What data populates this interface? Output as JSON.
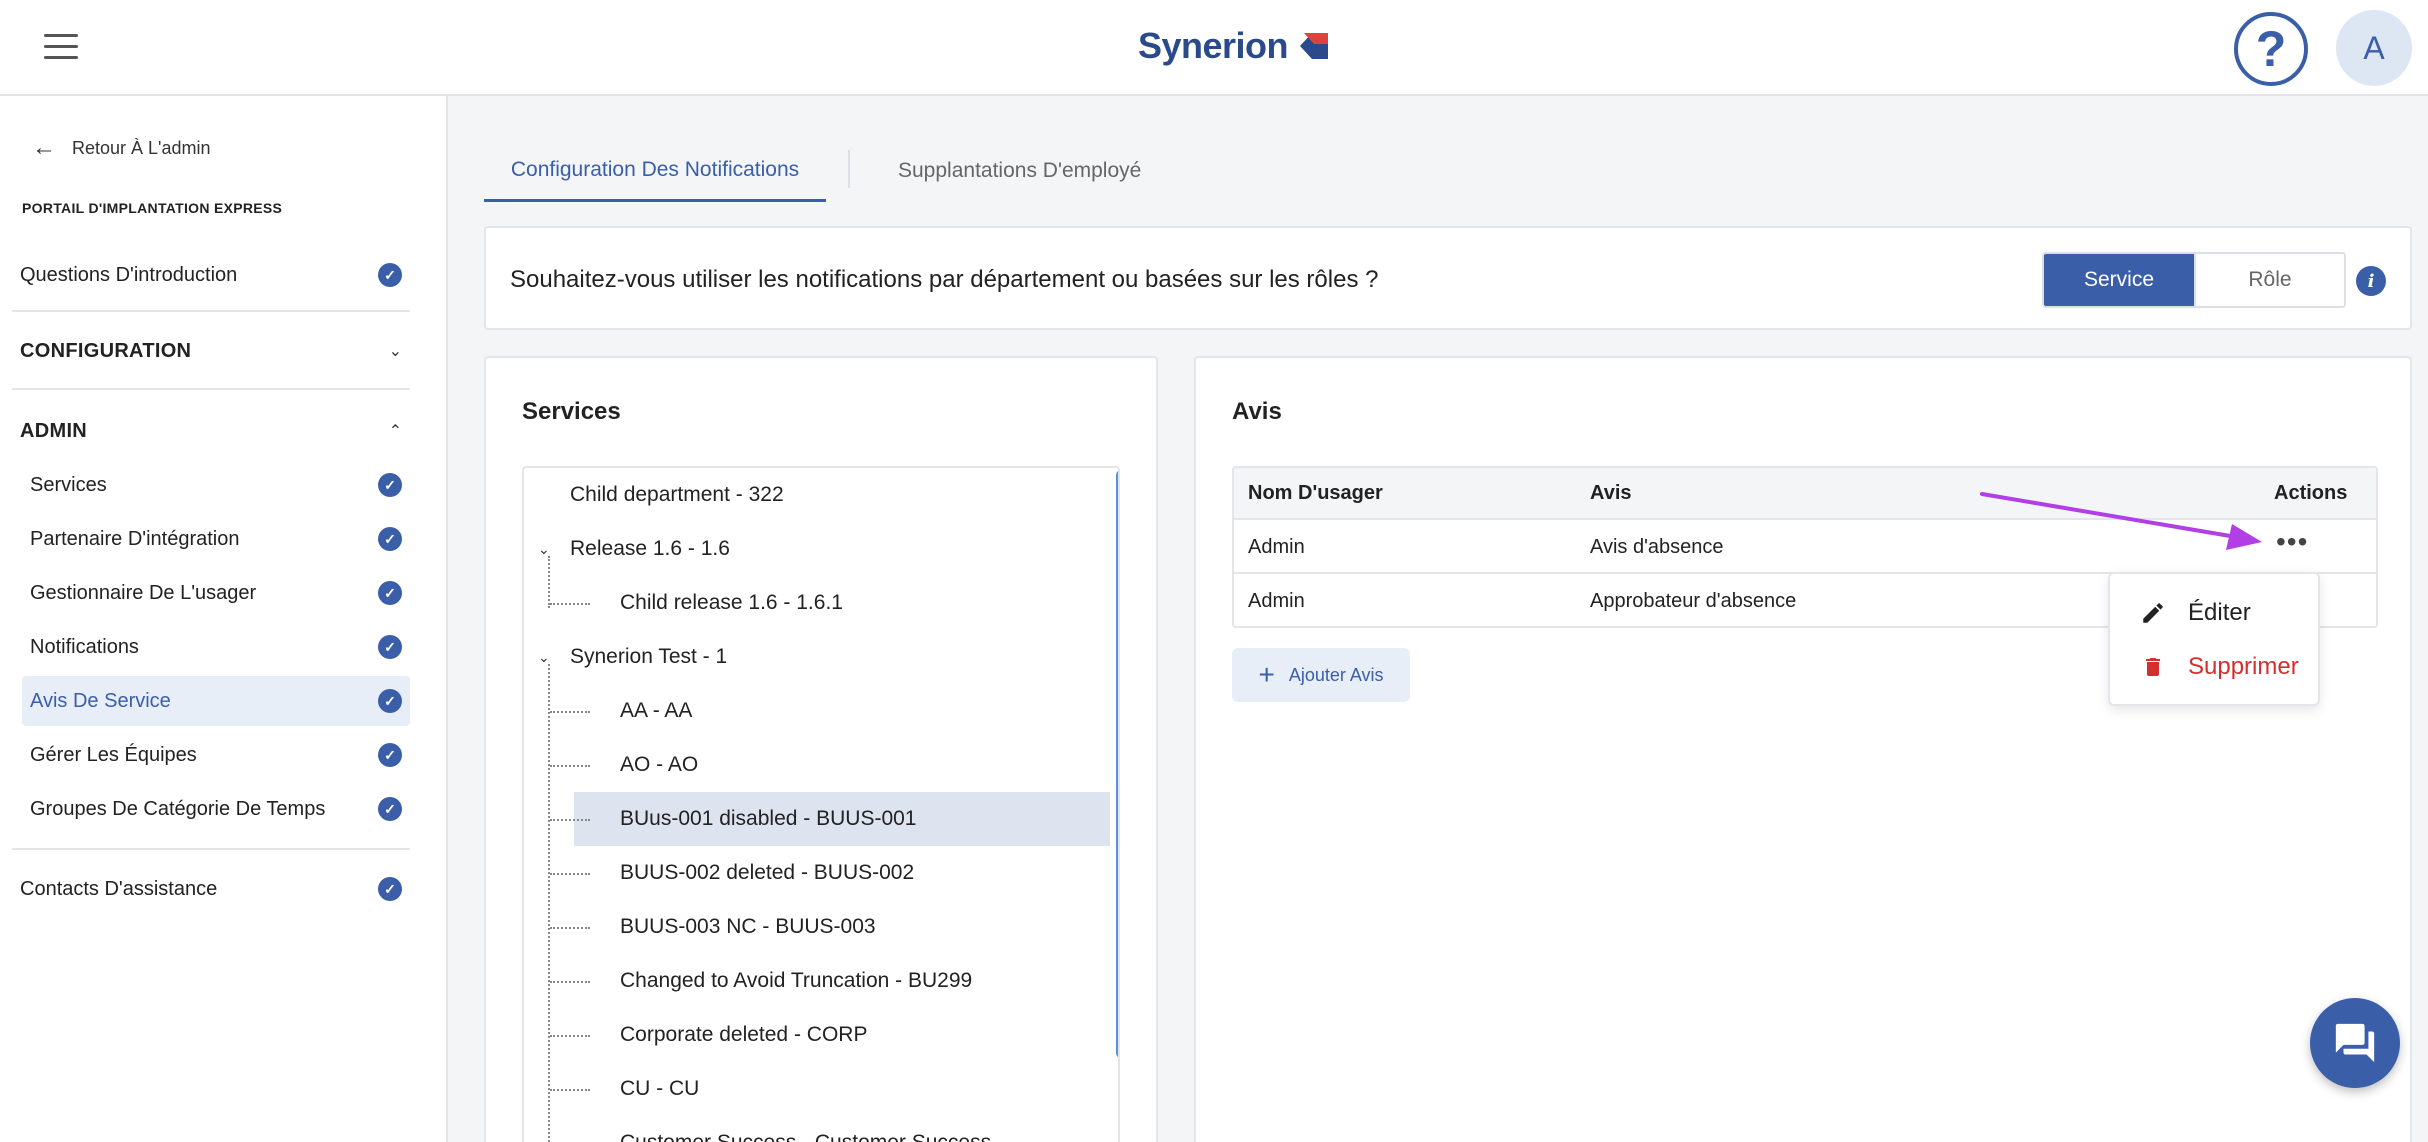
{
  "header": {
    "logo_text": "Synerion",
    "help_label": "?",
    "avatar_initial": "A"
  },
  "sidebar": {
    "back_label": "Retour À L'admin",
    "portal_title": "PORTAIL D'IMPLANTATION EXPRESS",
    "intro_label": "Questions D'introduction",
    "config_label": "CONFIGURATION",
    "admin_label": "ADMIN",
    "admin_items": [
      {
        "label": "Services"
      },
      {
        "label": "Partenaire D'intégration"
      },
      {
        "label": "Gestionnaire De L'usager"
      },
      {
        "label": "Notifications"
      },
      {
        "label": "Avis De Service"
      },
      {
        "label": "Gérer Les Équipes"
      },
      {
        "label": "Groupes De Catégorie De Temps"
      }
    ],
    "support_label": "Contacts D'assistance"
  },
  "tabs": [
    {
      "label": "Configuration Des Notifications"
    },
    {
      "label": "Supplantations D'employé"
    }
  ],
  "question": {
    "text": "Souhaitez-vous utiliser les notifications par département ou basées sur les rôles ?",
    "options": [
      {
        "label": "Service"
      },
      {
        "label": "Rôle"
      }
    ],
    "info_icon": "i"
  },
  "services_panel": {
    "title": "Services",
    "tree": [
      {
        "label": "Child department - 322"
      },
      {
        "label": "Release 1.6 - 1.6"
      },
      {
        "label": "Child release 1.6 - 1.6.1"
      },
      {
        "label": "Synerion Test - 1"
      },
      {
        "label": "AA - AA"
      },
      {
        "label": "AO - AO"
      },
      {
        "label": "BUus-001 disabled - BUUS-001"
      },
      {
        "label": "BUUS-002 deleted - BUUS-002"
      },
      {
        "label": "BUUS-003 NC - BUUS-003"
      },
      {
        "label": "Changed to Avoid Truncation - BU299"
      },
      {
        "label": "Corporate deleted - CORP"
      },
      {
        "label": "CU - CU"
      },
      {
        "label": "Customer Success - Customer Success"
      }
    ]
  },
  "avis_panel": {
    "title": "Avis",
    "columns": {
      "user": "Nom D'usager",
      "avis": "Avis",
      "actions": "Actions"
    },
    "rows": [
      {
        "user": "Admin",
        "avis": "Avis d'absence"
      },
      {
        "user": "Admin",
        "avis": "Approbateur d'absence"
      }
    ],
    "add_label": "Ajouter Avis"
  },
  "action_menu": {
    "edit_label": "Éditer",
    "delete_label": "Supprimer"
  },
  "colors": {
    "accent": "#3a5ea8",
    "danger": "#d32f2f",
    "annotation": "#b23ee6"
  }
}
